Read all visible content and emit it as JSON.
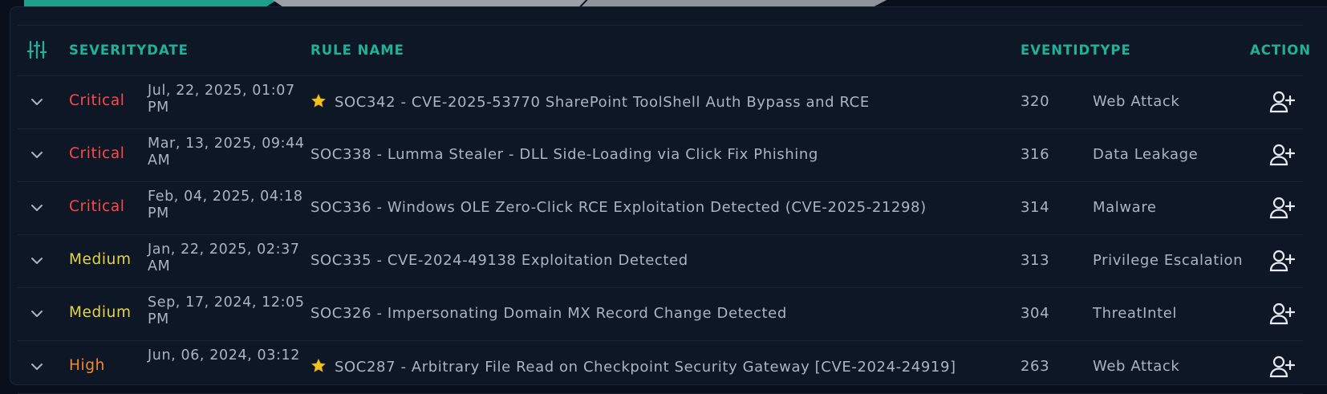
{
  "colors": {
    "accent": "#1fb199",
    "critical": "#ff4747",
    "medium": "#e3d549",
    "high": "#f28a2a",
    "background": "#0e1726"
  },
  "header": {
    "filter_icon": "filter-sliders-icon",
    "severity_date": "SEVERITYDATE",
    "rule_name": "RULE NAME",
    "eventid_type": "EVENTIDTYPE",
    "action": "ACTION"
  },
  "rows": [
    {
      "severity": "Critical",
      "severity_level": "critical",
      "date_line1": "Jul, 22, 2025, 01:07",
      "date_line2": "PM",
      "starred": true,
      "rule": "SOC342 - CVE-2025-53770 SharePoint ToolShell Auth Bypass and RCE",
      "event_id": "320",
      "type": "Web Attack"
    },
    {
      "severity": "Critical",
      "severity_level": "critical",
      "date_line1": "Mar, 13, 2025, 09:44",
      "date_line2": "AM",
      "starred": false,
      "rule": "SOC338 - Lumma Stealer - DLL Side-Loading via Click Fix Phishing",
      "event_id": "316",
      "type": "Data Leakage"
    },
    {
      "severity": "Critical",
      "severity_level": "critical",
      "date_line1": "Feb, 04, 2025, 04:18",
      "date_line2": "PM",
      "starred": false,
      "rule": "SOC336 - Windows OLE Zero-Click RCE Exploitation Detected (CVE-2025-21298)",
      "event_id": "314",
      "type": "Malware"
    },
    {
      "severity": "Medium",
      "severity_level": "medium",
      "date_line1": "Jan, 22, 2025, 02:37",
      "date_line2": "AM",
      "starred": false,
      "rule": "SOC335 - CVE-2024-49138 Exploitation Detected",
      "event_id": "313",
      "type": "Privilege Escalation"
    },
    {
      "severity": "Medium",
      "severity_level": "medium",
      "date_line1": "Sep, 17, 2024, 12:05",
      "date_line2": "PM",
      "starred": false,
      "rule": "SOC326 - Impersonating Domain MX Record Change Detected",
      "event_id": "304",
      "type": "ThreatIntel"
    },
    {
      "severity": "High",
      "severity_level": "high",
      "date_line1": "Jun, 06, 2024, 03:12",
      "date_line2": "",
      "starred": true,
      "rule": "SOC287 - Arbitrary File Read on Checkpoint Security Gateway [CVE-2024-24919]",
      "event_id": "263",
      "type": "Web Attack"
    }
  ]
}
